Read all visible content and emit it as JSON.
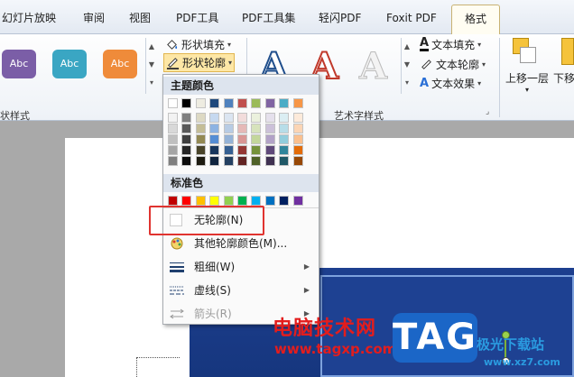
{
  "tabs": [
    {
      "label": "幻灯片放映"
    },
    {
      "label": "审阅"
    },
    {
      "label": "视图"
    },
    {
      "label": "PDF工具"
    },
    {
      "label": "PDF工具集"
    },
    {
      "label": "轻闪PDF"
    },
    {
      "label": "Foxit PDF"
    },
    {
      "label": "格式"
    }
  ],
  "ribbon": {
    "shape_styles_label": "状样式",
    "style_buttons": [
      {
        "label": "Abc",
        "color": "#7b5ea7"
      },
      {
        "label": "Abc",
        "color": "#3aa6c3"
      },
      {
        "label": "Abc",
        "color": "#ef8b3a"
      }
    ],
    "shape_fill": "形状填充",
    "shape_outline": "形状轮廓",
    "wordart_label": "艺术字样式",
    "wordart_letters": [
      "A",
      "A",
      "A"
    ],
    "text_fill": "文本填充",
    "text_outline": "文本轮廓",
    "text_effect": "文本效果",
    "move_up": "上移一层",
    "move_down": "下移"
  },
  "dropdown": {
    "theme_colors_title": "主题颜色",
    "standard_colors_title": "标准色",
    "theme_top_row": [
      "#ffffff",
      "#000000",
      "#eeece1",
      "#1f497d",
      "#4f81bd",
      "#c0504d",
      "#9bbb59",
      "#8064a2",
      "#4bacc6",
      "#f79646"
    ],
    "theme_shades": [
      [
        "#f2f2f2",
        "#7f7f7f",
        "#ddd9c3",
        "#c6d9f0",
        "#dbe5f1",
        "#f2dcdb",
        "#ebf1dd",
        "#e5e0ec",
        "#dbeef3",
        "#fdeada"
      ],
      [
        "#d8d8d8",
        "#595959",
        "#c4bd97",
        "#8db3e2",
        "#b8cce4",
        "#e5b9b7",
        "#d7e3bc",
        "#ccc1d9",
        "#b7dde8",
        "#fbd5b5"
      ],
      [
        "#bfbfbf",
        "#3f3f3f",
        "#938953",
        "#548dd4",
        "#95b3d7",
        "#d99694",
        "#c3d69b",
        "#b2a2c7",
        "#92cddc",
        "#fac08f"
      ],
      [
        "#a5a5a5",
        "#262626",
        "#494429",
        "#17365d",
        "#366092",
        "#953734",
        "#76923c",
        "#5f497a",
        "#31859b",
        "#e36c09"
      ],
      [
        "#7f7f7f",
        "#0c0c0c",
        "#1d1b10",
        "#0f243e",
        "#244061",
        "#632423",
        "#4f6128",
        "#3f3151",
        "#205867",
        "#974806"
      ]
    ],
    "standard_colors": [
      "#c00000",
      "#ff0000",
      "#ffc000",
      "#ffff00",
      "#92d050",
      "#00b050",
      "#00b0f0",
      "#0070c0",
      "#002060",
      "#7030a0"
    ],
    "no_outline": "无轮廓(N)",
    "more_colors": "其他轮廓颜色(M)...",
    "weight": "粗细(W)",
    "dashes": "虚线(S)",
    "arrows": "箭头(R)"
  },
  "watermark": {
    "site_name": "电脑技术网",
    "url": "www.tagxp.com",
    "tag": "TAG",
    "right_text": "极光下载站",
    "right_url": "www.xz7.com"
  }
}
